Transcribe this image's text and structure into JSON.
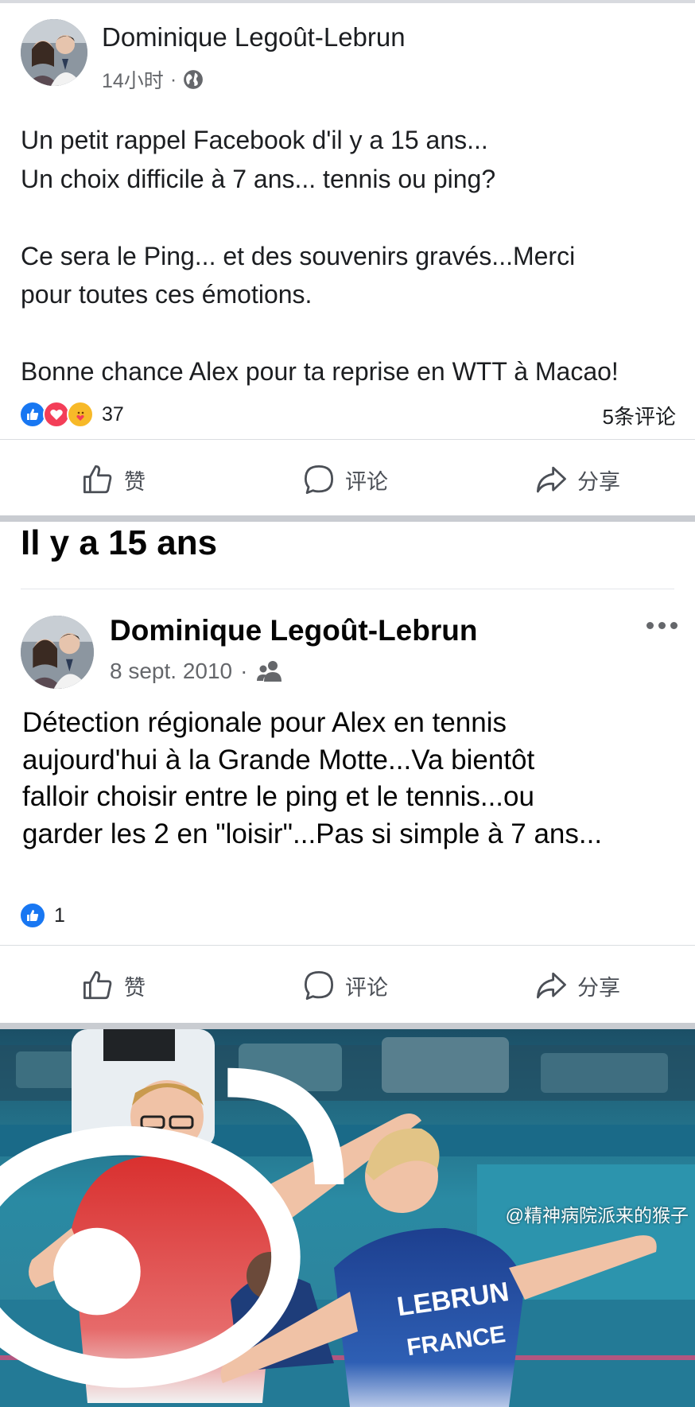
{
  "post1": {
    "author": "Dominique Legoût-Lebrun",
    "time": "14小时",
    "separator": "·",
    "paragraphs": [
      "Un petit rappel Facebook d'il y a 15 ans...",
      "Un choix difficile à 7 ans... tennis ou ping?",
      "",
      "Ce sera le Ping... et des souvenirs gravés...Merci",
      "pour toutes ces émotions.",
      "",
      "Bonne chance Alex pour ta reprise en WTT à Macao!"
    ],
    "reaction_count": "37",
    "comments": "5条评论",
    "icons": [
      "globe-icon",
      "like-reaction-icon",
      "love-reaction-icon",
      "care-reaction-icon"
    ]
  },
  "actions": {
    "like": "赞",
    "comment": "评论",
    "share": "分享"
  },
  "memory": {
    "title": "Il y a 15 ans",
    "author": "Dominique Legoût-Lebrun",
    "date": "8 sept. 2010",
    "separator": "·",
    "lines": [
      "Détection régionale pour Alex en tennis",
      "aujourd'hui à la Grande Motte...Va bientôt",
      "falloir choisir entre le ping et le tennis...ou",
      "garder les 2 en \"loisir\"...Pas si simple à 7 ans..."
    ],
    "reaction_count": "1"
  },
  "photo": {
    "jersey_name": "LEBRUN",
    "jersey_country": "FRANCE",
    "watermark": "@精神病院派来的猴子"
  },
  "colors": {
    "facebook_blue": "#1877f2",
    "love_red": "#f33e58",
    "care_yellow": "#f7b928",
    "secondary_text": "#65676b"
  }
}
